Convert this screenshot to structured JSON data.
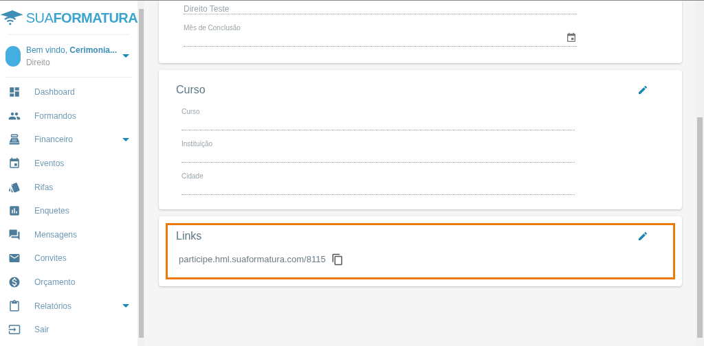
{
  "sidebar": {
    "logo": {
      "word_1": "SUA",
      "word_2": "FORMATURA"
    },
    "user": {
      "greeting": "Bem vindo,",
      "name": "Cerimonia...",
      "course": "Direito"
    },
    "items": [
      {
        "label": "Dashboard",
        "expandable": false
      },
      {
        "label": "Formandos",
        "expandable": false
      },
      {
        "label": "Financeiro",
        "expandable": true
      },
      {
        "label": "Eventos",
        "expandable": false
      },
      {
        "label": "Rifas",
        "expandable": false
      },
      {
        "label": "Enquetes",
        "expandable": false
      },
      {
        "label": "Mensagens",
        "expandable": false
      },
      {
        "label": "Convites",
        "expandable": false
      },
      {
        "label": "Orçamento",
        "expandable": false
      },
      {
        "label": "Relatórios",
        "expandable": true
      },
      {
        "label": "Sair",
        "expandable": false
      }
    ]
  },
  "cards": [
    {
      "fields": [
        {
          "value": "Direito Teste"
        },
        {
          "label": "Mês de Conclusão",
          "kind": "date"
        }
      ]
    },
    {
      "title": "Curso",
      "editable": true,
      "fields": [
        {
          "label": "Curso",
          "kind": "text"
        },
        {
          "label": "Instituição",
          "kind": "text"
        },
        {
          "label": "Cidade",
          "kind": "text"
        }
      ]
    },
    {
      "title": "Links",
      "editable": true,
      "highlighted": true,
      "link": "participe.hml.suaformatura.com/8115"
    }
  ]
}
